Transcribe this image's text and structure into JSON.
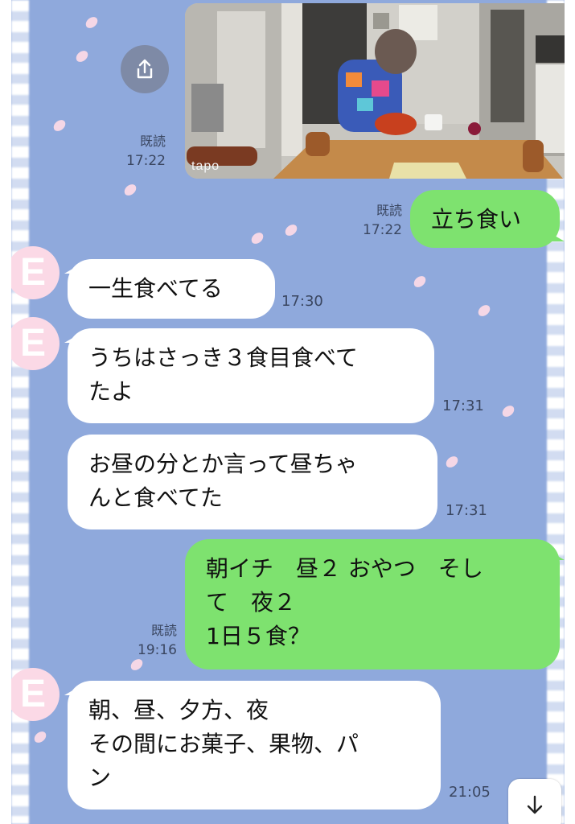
{
  "colors": {
    "background": "#8fa9dc",
    "incoming_bubble": "#ffffff",
    "outgoing_bubble": "#7ee26f",
    "avatar": "#fbd9e6"
  },
  "photo_message": {
    "read_label": "既読",
    "time": "17:22",
    "watermark": "tapo"
  },
  "messages": [
    {
      "side": "outgoing",
      "text": "立ち食い",
      "read_label": "既読",
      "time": "17:22"
    },
    {
      "side": "incoming",
      "avatar": "E",
      "text": "一生食べてる",
      "time": "17:30"
    },
    {
      "side": "incoming",
      "avatar": "E",
      "text": "うちはさっき３食目食べて\nたよ",
      "time": "17:31"
    },
    {
      "side": "incoming",
      "text": "お昼の分とか言って昼ちゃ\nんと食べてた",
      "time": "17:31"
    },
    {
      "side": "outgoing",
      "text": "朝イチ　昼２ おやつ　そし\nて　夜２\n1日５食？",
      "read_label": "既読",
      "time": "19:16"
    },
    {
      "side": "incoming",
      "avatar": "E",
      "text": "朝、昼、夕方、夜\nその間にお菓子、果物、パ\nン",
      "time": "21:05"
    }
  ],
  "icons": {
    "share": "share-icon",
    "scroll_down": "arrow-down-icon"
  }
}
